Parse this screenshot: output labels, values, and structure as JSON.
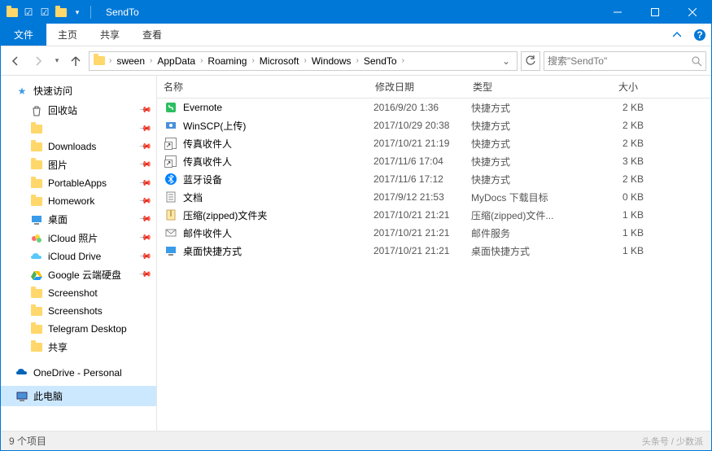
{
  "titlebar": {
    "title": "SendTo"
  },
  "ribbon": {
    "file": "文件",
    "tabs": [
      "主页",
      "共享",
      "查看"
    ]
  },
  "breadcrumb": [
    "sween",
    "AppData",
    "Roaming",
    "Microsoft",
    "Windows",
    "SendTo"
  ],
  "search": {
    "placeholder": "搜索\"SendTo\""
  },
  "columns": {
    "name": "名称",
    "date": "修改日期",
    "type": "类型",
    "size": "大小"
  },
  "sidebar": {
    "quick_access": "快速访问",
    "items": [
      {
        "label": "回收站",
        "icon": "recycle",
        "pinned": true
      },
      {
        "label": "",
        "icon": "folder",
        "pinned": true
      },
      {
        "label": "Downloads",
        "icon": "folder",
        "pinned": true
      },
      {
        "label": "图片",
        "icon": "folder",
        "pinned": true
      },
      {
        "label": "PortableApps",
        "icon": "folder",
        "pinned": true
      },
      {
        "label": "Homework",
        "icon": "folder",
        "pinned": true
      },
      {
        "label": "桌面",
        "icon": "desktop",
        "pinned": true
      },
      {
        "label": "iCloud 照片",
        "icon": "icloud-photos",
        "pinned": true
      },
      {
        "label": "iCloud Drive",
        "icon": "icloud-drive",
        "pinned": true
      },
      {
        "label": "Google 云端硬盘",
        "icon": "gdrive",
        "pinned": true
      },
      {
        "label": "Screenshot",
        "icon": "folder",
        "pinned": false
      },
      {
        "label": "Screenshots",
        "icon": "folder",
        "pinned": false
      },
      {
        "label": "Telegram Desktop",
        "icon": "folder",
        "pinned": false
      },
      {
        "label": "共享",
        "icon": "folder",
        "pinned": false
      }
    ],
    "onedrive": "OneDrive - Personal",
    "thispc": "此电脑"
  },
  "files": [
    {
      "name": "Evernote",
      "date": "2016/9/20 1:36",
      "type": "快捷方式",
      "size": "2 KB",
      "icon": "evernote"
    },
    {
      "name": "WinSCP(上传)",
      "date": "2017/10/29 20:38",
      "type": "快捷方式",
      "size": "2 KB",
      "icon": "winscp"
    },
    {
      "name": "传真收件人",
      "date": "2017/10/21 21:19",
      "type": "快捷方式",
      "size": "2 KB",
      "icon": "fax"
    },
    {
      "name": "传真收件人",
      "date": "2017/11/6 17:04",
      "type": "快捷方式",
      "size": "3 KB",
      "icon": "fax"
    },
    {
      "name": "蓝牙设备",
      "date": "2017/11/6 17:12",
      "type": "快捷方式",
      "size": "2 KB",
      "icon": "bluetooth"
    },
    {
      "name": "文档",
      "date": "2017/9/12 21:53",
      "type": "MyDocs 下载目标",
      "size": "0 KB",
      "icon": "doc"
    },
    {
      "name": "压缩(zipped)文件夹",
      "date": "2017/10/21 21:21",
      "type": "压缩(zipped)文件...",
      "size": "1 KB",
      "icon": "zip"
    },
    {
      "name": "邮件收件人",
      "date": "2017/10/21 21:21",
      "type": "邮件服务",
      "size": "1 KB",
      "icon": "mail"
    },
    {
      "name": "桌面快捷方式",
      "date": "2017/10/21 21:21",
      "type": "桌面快捷方式",
      "size": "1 KB",
      "icon": "desklink"
    }
  ],
  "status": {
    "count": "9 个项目",
    "watermark": "头条号 / 少数派"
  }
}
